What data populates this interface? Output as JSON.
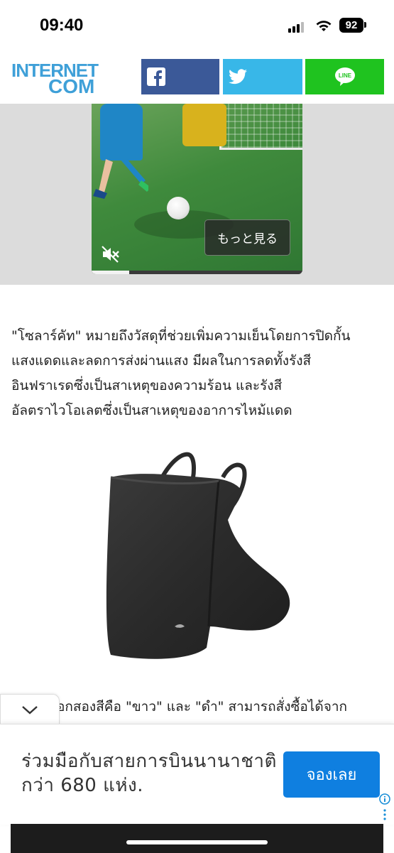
{
  "status_bar": {
    "time": "09:40",
    "battery": "92"
  },
  "header": {
    "logo": {
      "line1": "INTERNET",
      "line2": "COM"
    },
    "share": {
      "facebook_icon": "facebook-icon",
      "twitter_icon": "twitter-icon",
      "line_icon": "line-icon",
      "line_label": "LINE"
    }
  },
  "video": {
    "more_label": "もっと見る",
    "muted": true,
    "progress": 0.18
  },
  "article": {
    "paragraph_lines": [
      "\"โซลาร์คัท\" หมายถึงวัสดุที่ช่วยเพิ่มความเย็นโดยการปิดกั้น",
      "แสงแดดและลดการส่งผ่านแสง มีผลในการลดทั้งรังสี",
      "อินฟราเรดซึ่งเป็นสาเหตุของความร้อน และรังสี",
      "อัลตราไวโอเลตซึ่งเป็นสาเหตุของอาการไหม้แดด"
    ],
    "partial_paragraph": "ีอกสองสีคือ \"ขาว\" และ \"ดำ\" สามารถสั่งซื้อได้จาก"
  },
  "ad": {
    "headline": "ร่วมมือกับสายการบินนานาชาติกว่า 680 แห่ง.",
    "cta": "จองเลย"
  },
  "colors": {
    "facebook": "#3b5998",
    "twitter": "#38b7e8",
    "line": "#1fc31f",
    "ad_cta": "#0f7fe0",
    "logo": "#3fa0d8"
  }
}
